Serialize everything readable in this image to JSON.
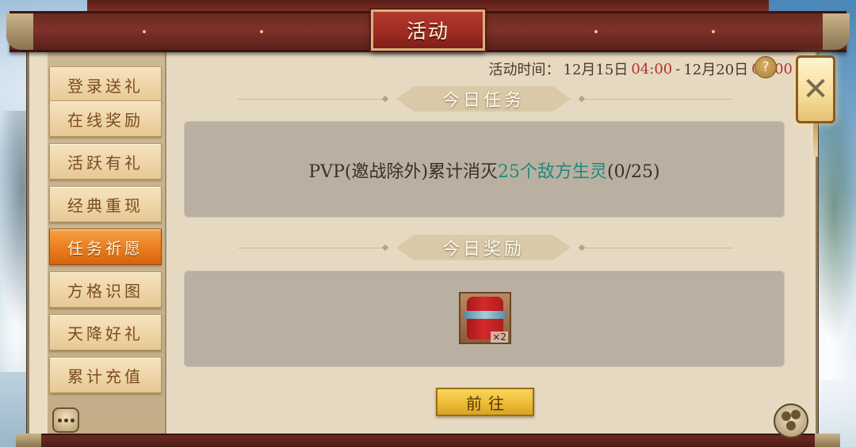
{
  "header": {
    "title": "活动"
  },
  "sidebar": {
    "items": [
      {
        "label": "登录送礼",
        "active": false
      },
      {
        "label": "在线奖励",
        "active": false
      },
      {
        "label": "活跃有礼",
        "active": false
      },
      {
        "label": "经典重现",
        "active": false
      },
      {
        "label": "任务祈愿",
        "active": true
      },
      {
        "label": "方格识图",
        "active": false
      },
      {
        "label": "天降好礼",
        "active": false
      },
      {
        "label": "累计充值",
        "active": false
      }
    ]
  },
  "activity_time": {
    "label": "活动时间：",
    "start_date": "12月15日",
    "start_time": "04:00",
    "separator": "-",
    "end_date": "12月20日",
    "end_time": "04:00"
  },
  "help": {
    "symbol": "?"
  },
  "today_task": {
    "heading": "今日任务",
    "prefix": "PVP(邀战除外)累计消灭",
    "highlight": "25个敌方生灵",
    "progress": "(0/25)"
  },
  "today_reward": {
    "heading": "今日奖励",
    "items": [
      {
        "icon": "red-pouch-icon",
        "count": "×2"
      }
    ]
  },
  "go_button": {
    "label": "前往"
  },
  "close": {
    "symbol": "✕"
  },
  "colors": {
    "active_tab": "#ea7d1e",
    "highlight_text": "#1f8a7a",
    "time_red": "#b2332a",
    "go_button": "#efc03a"
  }
}
